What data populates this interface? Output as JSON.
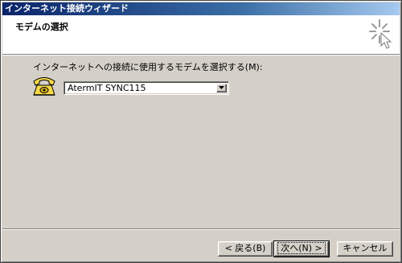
{
  "window": {
    "title": "インターネット接続ウィザード"
  },
  "header": {
    "title": "モデムの選択",
    "icon": "wizard-sparkle-icon"
  },
  "main": {
    "prompt": "インターネットへの接続に使用するモデムを選択する(M):",
    "icon": "telephone-icon",
    "modem_select": {
      "value": "AtermIT SYNC115"
    }
  },
  "buttons": {
    "back": "< 戻る(B)",
    "next": "次へ(N) >",
    "cancel": "キャンセル"
  },
  "colors": {
    "titlebar_start": "#0a246a",
    "titlebar_end": "#a6caf0",
    "face": "#d4d0c8"
  }
}
